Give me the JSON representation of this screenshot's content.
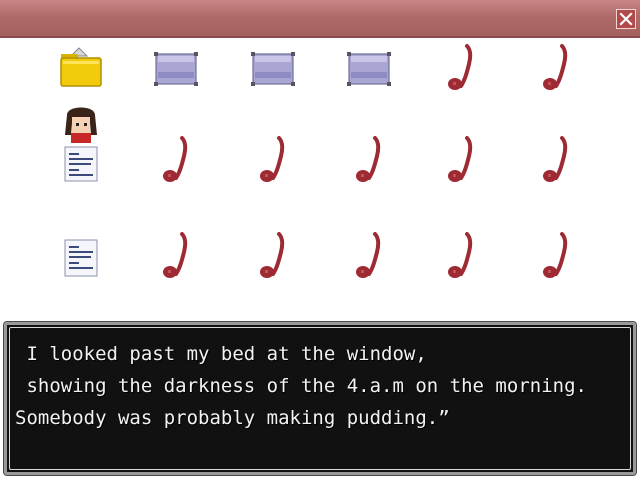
{
  "window": {
    "close_icon": "close-x-icon",
    "accent": "#b06a6a"
  },
  "grid": {
    "rows": [
      [
        "folder-icon",
        "envelope-icon",
        "envelope-icon",
        "envelope-icon",
        "music-note-icon",
        "music-note-icon"
      ],
      [
        "character-portrait-note-icon",
        "music-note-icon",
        "music-note-icon",
        "music-note-icon",
        "music-note-icon",
        "music-note-icon"
      ],
      [
        "text-document-icon",
        "music-note-icon",
        "music-note-icon",
        "music-note-icon",
        "music-note-icon",
        "music-note-icon"
      ]
    ]
  },
  "dialog": {
    "lines": [
      " I looked past my bed at the window,",
      " showing the darkness of the 4.a.m on the morning.",
      "Somebody was probably making pudding.”"
    ]
  }
}
